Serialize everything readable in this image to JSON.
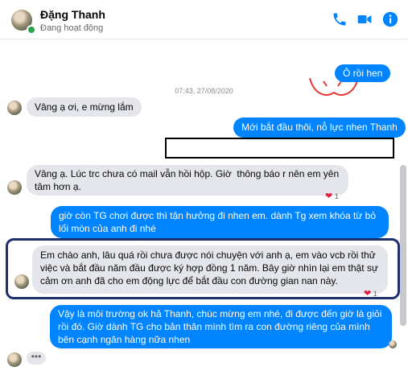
{
  "header": {
    "name": "Đặng Thanh",
    "status": "Đang hoạt động"
  },
  "timestamp": "07:43, 27/08/2020",
  "messages": [
    {
      "side": "out",
      "text": "Ô rồi hen"
    },
    {
      "side": "in",
      "text": "Vâng ạ ơi, e mừng lắm"
    },
    {
      "side": "out",
      "text": "Mới bắt đầu thôi, nỗ lực nhen Thanh"
    },
    {
      "side": "in",
      "text": "Vâng ạ. Lúc trc chưa có mail vẫn hồi hộp. Giờ  thông báo r nên em yên tâm hơn ạ.",
      "reaction": "1"
    },
    {
      "side": "out",
      "text": "giờ còn TG chơi được thì tận hưởng đi nhen em. dành Tg xem khóa từ bỏ lối mòn của anh đi nhé"
    },
    {
      "side": "in",
      "text": "Em chào anh, lâu quá rồi chưa được nói chuyện với anh ạ, em vào vcb rồi thử việc và bắt đầu năm đầu được ký hợp đồng 1 năm. Bây giờ nhìn lại em thật sự cảm ơn anh đã cho em động lực để bắt đầu con đường gian nan này.",
      "reaction": "1"
    },
    {
      "side": "out",
      "text": "Vậy là môi trường ok hả Thanh, chúc mừng em nhé, đi được đến giờ là giỏi rồi đó. Giờ dành TG cho bản thân mình tìm ra con đường riêng của mình bên cạnh ngân hàng nữa nhen"
    }
  ],
  "typing": "•••",
  "colors": {
    "accent": "#0084ff",
    "frame": "#1d2f6f",
    "incoming": "#e4e6eb"
  },
  "icons": [
    "phone-icon",
    "video-icon",
    "info-icon",
    "heart-icon"
  ]
}
